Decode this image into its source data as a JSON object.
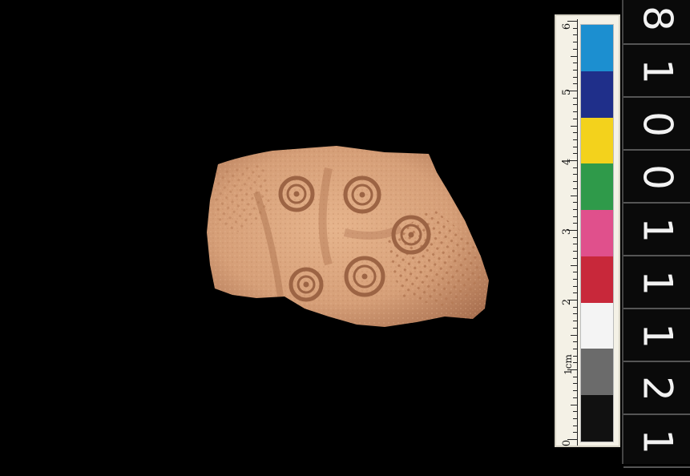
{
  "scene": {
    "subject": "pottery-sherd",
    "background_color": "#000000",
    "sherd_color": "#d9a27a"
  },
  "scale_bar": {
    "unit_label": "1cm",
    "tick_labels": [
      "0",
      "2",
      "3",
      "4",
      "5",
      "6"
    ],
    "swatches": [
      {
        "name": "cyan",
        "color": "#1c8fd0"
      },
      {
        "name": "blue",
        "color": "#1f2f8a"
      },
      {
        "name": "yellow",
        "color": "#f3d21c"
      },
      {
        "name": "green",
        "color": "#2f9a4a"
      },
      {
        "name": "magenta",
        "color": "#e0508c"
      },
      {
        "name": "red",
        "color": "#c8283a"
      },
      {
        "name": "white",
        "color": "#f4f4f4"
      },
      {
        "name": "gray",
        "color": "#6b6b6b"
      },
      {
        "name": "black",
        "color": "#111111"
      }
    ]
  },
  "catalogue_number": {
    "digits": [
      "8",
      "1",
      "0",
      "0",
      "1",
      "1",
      "1",
      "2",
      "1"
    ]
  }
}
